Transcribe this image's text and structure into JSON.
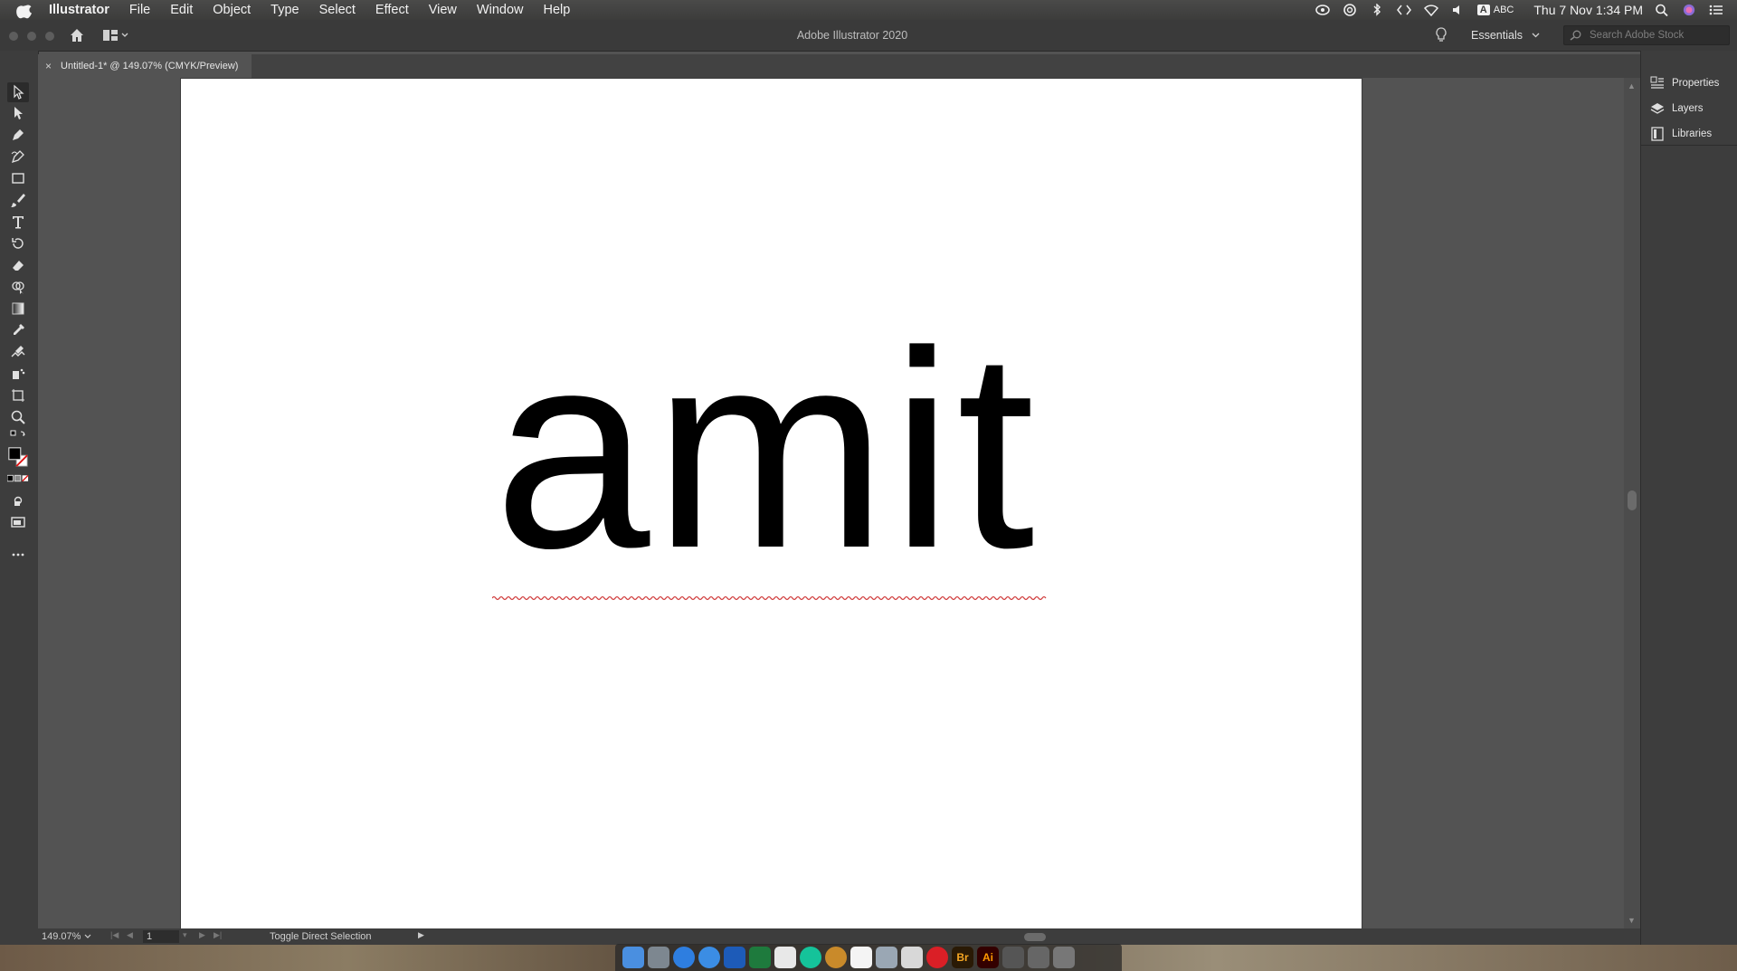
{
  "menubar": {
    "items": [
      "Illustrator",
      "File",
      "Edit",
      "Object",
      "Type",
      "Select",
      "Effect",
      "View",
      "Window",
      "Help"
    ],
    "input_source": "ABC",
    "input_letter": "A",
    "clock": "Thu 7 Nov  1:34 PM"
  },
  "appbar": {
    "title": "Adobe Illustrator 2020",
    "workspace": "Essentials",
    "search_placeholder": "Search Adobe Stock"
  },
  "document_tab": {
    "close": "×",
    "label": "Untitled-1* @ 149.07% (CMYK/Preview)"
  },
  "artboard": {
    "text": "amit"
  },
  "right_panel": {
    "items": [
      "Properties",
      "Layers",
      "Libraries"
    ]
  },
  "statusbar": {
    "zoom": "149.07%",
    "artboard_number": "1",
    "tool_label": "Toggle Direct Selection"
  },
  "dock": {
    "bridge_label": "Br",
    "illustrator_label": "Ai"
  },
  "colors": {
    "ui_background": "#535353",
    "panel": "#3d3d3d",
    "artboard": "#ffffff",
    "spellcheck": "#d03a3a",
    "illustrator_orange": "#ff9a00"
  }
}
